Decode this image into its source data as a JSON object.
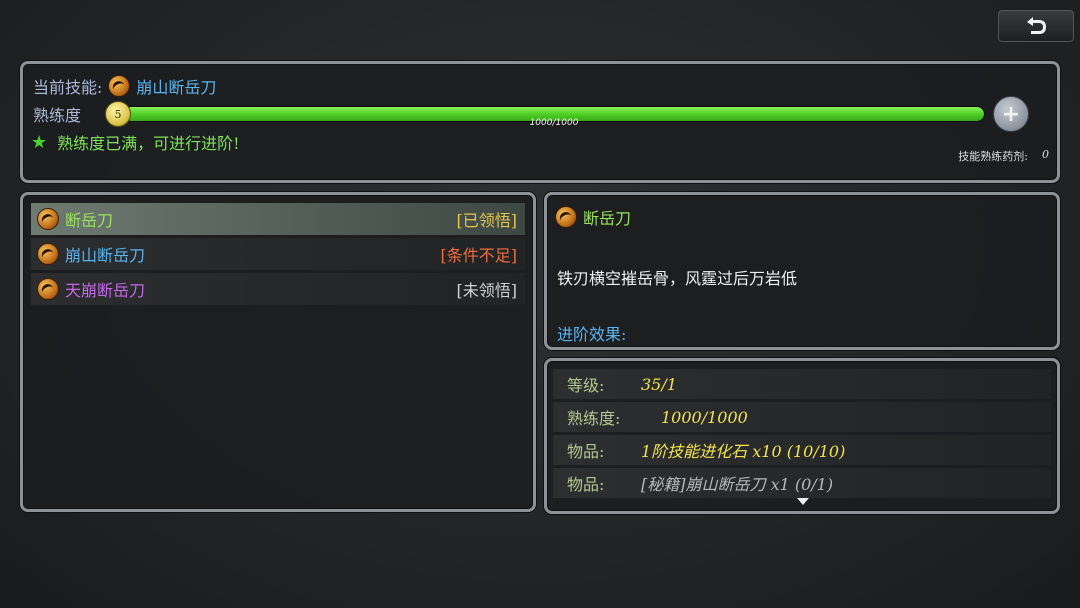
{
  "current": {
    "label": "当前技能:",
    "skill_name": "崩山断岳刀"
  },
  "proficiency": {
    "label": "熟练度",
    "level": "5",
    "value_text": "1000/1000",
    "fill_fraction": 1.0,
    "full_message": "熟练度已满，可进行进阶!",
    "star": "★"
  },
  "potion": {
    "label": "技能熟练药剂:",
    "count": "0"
  },
  "skills": [
    {
      "name": "断岳刀",
      "status": "[已领悟]"
    },
    {
      "name": "崩山断岳刀",
      "status": "[条件不足]"
    },
    {
      "name": "天崩断岳刀",
      "status": "[未领悟]"
    }
  ],
  "detail": {
    "name": "断岳刀",
    "description": "铁刃横空摧岳骨，风霆过后万岩低",
    "advance_label": "进阶效果:"
  },
  "requirements": [
    {
      "label": "等级:",
      "value": "35/1"
    },
    {
      "label": "熟练度:",
      "value": "1000/1000"
    },
    {
      "label": "物品:",
      "value": "1阶技能进化石 x10 (10/10)"
    },
    {
      "label": "物品:",
      "value": "[秘籍]崩山断岳刀 x1 (0/1)"
    }
  ],
  "colors": {
    "bar_fill": "#4fd126",
    "selected_row": "#6e7a72",
    "accent_blue": "#5ab4ee"
  }
}
